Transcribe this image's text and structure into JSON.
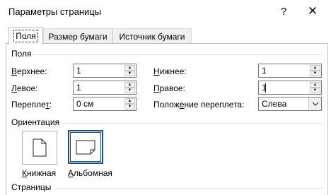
{
  "window": {
    "title": "Параметры страницы",
    "help_glyph": "?",
    "close_glyph": "✕"
  },
  "tabs": [
    {
      "label": "Поля",
      "active": true
    },
    {
      "label": "Размер бумаги",
      "active": false
    },
    {
      "label": "Источник бумаги",
      "active": false
    }
  ],
  "margins": {
    "group_title": "Поля",
    "top": {
      "label_key": "В",
      "label_rest": "ерхнее:",
      "value": "1"
    },
    "bottom": {
      "label_key": "Н",
      "label_rest": "ижнее:",
      "value": "1"
    },
    "left": {
      "label_key": "Л",
      "label_rest": "евое:",
      "value": "1"
    },
    "right": {
      "label_key": "П",
      "label_rest": "равое:",
      "value": "1"
    },
    "gutter": {
      "label_pre": "Перепле",
      "label_key": "т",
      "label_post": ":",
      "value": "0 см"
    },
    "gutter_position": {
      "label_pre": "Полож",
      "label_key": "е",
      "label_post": "ние переплета:",
      "value": "Слева"
    }
  },
  "orientation": {
    "group_title": "Ориентация",
    "portrait": {
      "label_key": "К",
      "label_rest": "нижная"
    },
    "landscape": {
      "label_key": "А",
      "label_rest": "льбомная"
    }
  },
  "pages": {
    "group_title": "Страницы"
  },
  "colors": {
    "selected_border": "#1f4e79",
    "field_border": "#7a7a7a"
  }
}
